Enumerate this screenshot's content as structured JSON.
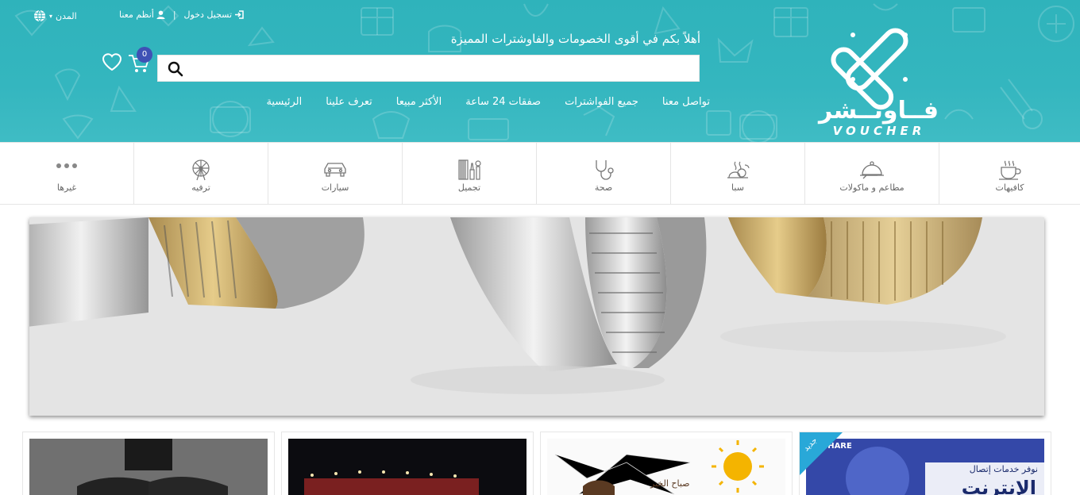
{
  "topbar": {
    "cities_label": "المدن",
    "register_label": "تسجيل دخول",
    "join_label": "أنظم معنا",
    "separator": "|"
  },
  "header": {
    "tagline": "أهلاً بكم في أقوى الخصومات والفاوشترات المميزة",
    "search_placeholder": "",
    "cart_count": "0",
    "logo_ar": "فــاوتــشر",
    "logo_en": "VOUCHER"
  },
  "nav": {
    "items": [
      "الرئيسية",
      "تعرف علينا",
      "الأكثر مبيعا",
      "صفقات 24 ساعة",
      "جميع الفواشترات",
      "تواصل معنا"
    ]
  },
  "categories": {
    "items": [
      {
        "label": "غيرها",
        "icon": "more-icon"
      },
      {
        "label": "ترفيه",
        "icon": "ferris-wheel-icon"
      },
      {
        "label": "سيارات",
        "icon": "car-icon"
      },
      {
        "label": "تجميل",
        "icon": "makeup-icon"
      },
      {
        "label": "صحة",
        "icon": "stethoscope-icon"
      },
      {
        "label": "سبا",
        "icon": "spa-icon"
      },
      {
        "label": "مطاعم و ماكولات",
        "icon": "cloche-icon"
      },
      {
        "label": "كافيهات",
        "icon": "coffee-cup-icon"
      }
    ]
  },
  "cards": {
    "card4": {
      "ribbon": "جديد",
      "img_caption_top": "نوفر خدمات إتصال",
      "img_caption_main": "الإنترنت",
      "brand": "SHARE"
    },
    "card3": {
      "img_caption": "صباح الخير"
    }
  },
  "colors": {
    "header_bg": "#34b6bf",
    "cart_badge": "#3f51b5",
    "ribbon": "#29a8d8"
  }
}
